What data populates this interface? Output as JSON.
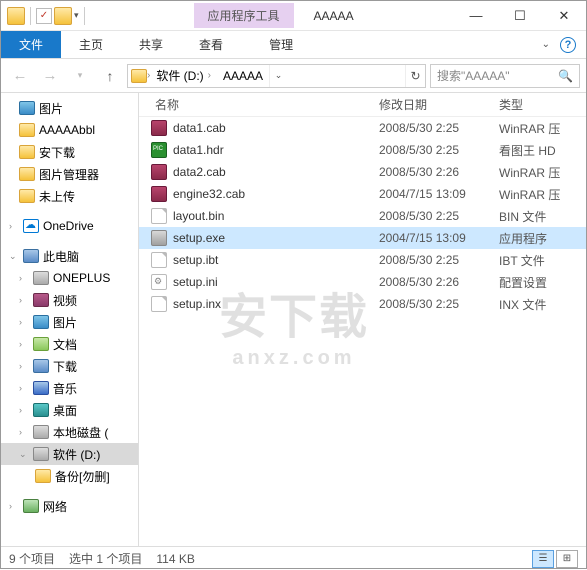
{
  "titlebar": {
    "contextual": "应用程序工具",
    "title": "AAAAA"
  },
  "ribbon": {
    "file": "文件",
    "home": "主页",
    "share": "共享",
    "view": "查看",
    "manage": "管理"
  },
  "address": {
    "drive": "软件 (D:)",
    "folder": "AAAAA"
  },
  "search": {
    "placeholder": "搜索\"AAAAA\""
  },
  "tree": {
    "pictures": "图片",
    "aaaaabbl": "AAAAAbbl",
    "axz": "安下载",
    "picmgr": "图片管理器",
    "wsc": "未上传",
    "onedrive": "OneDrive",
    "thispc": "此电脑",
    "oneplus": "ONEPLUS",
    "video": "视频",
    "pics2": "图片",
    "docs": "文档",
    "dl": "下载",
    "music": "音乐",
    "desktop": "桌面",
    "ldisk": "本地磁盘 (",
    "sdisk": "软件 (D:)",
    "backup": "备份[勿删]",
    "net": "网络"
  },
  "columns": {
    "name": "名称",
    "date": "修改日期",
    "type": "类型"
  },
  "files": [
    {
      "name": "data1.cab",
      "date": "2008/5/30 2:25",
      "type": "WinRAR 压",
      "ico": "cab",
      "sel": false
    },
    {
      "name": "data1.hdr",
      "date": "2008/5/30 2:25",
      "type": "看图王 HD",
      "ico": "hdr",
      "sel": false
    },
    {
      "name": "data2.cab",
      "date": "2008/5/30 2:26",
      "type": "WinRAR 压",
      "ico": "cab",
      "sel": false
    },
    {
      "name": "engine32.cab",
      "date": "2004/7/15 13:09",
      "type": "WinRAR 压",
      "ico": "cab",
      "sel": false
    },
    {
      "name": "layout.bin",
      "date": "2008/5/30 2:25",
      "type": "BIN 文件",
      "ico": "doc",
      "sel": false
    },
    {
      "name": "setup.exe",
      "date": "2004/7/15 13:09",
      "type": "应用程序",
      "ico": "exe",
      "sel": true
    },
    {
      "name": "setup.ibt",
      "date": "2008/5/30 2:25",
      "type": "IBT 文件",
      "ico": "doc",
      "sel": false
    },
    {
      "name": "setup.ini",
      "date": "2008/5/30 2:26",
      "type": "配置设置",
      "ico": "ini",
      "sel": false
    },
    {
      "name": "setup.inx",
      "date": "2008/5/30 2:25",
      "type": "INX 文件",
      "ico": "doc",
      "sel": false
    }
  ],
  "status": {
    "count": "9 个项目",
    "selected": "选中 1 个项目",
    "size": "114 KB"
  },
  "watermark": {
    "main": "安下载",
    "sub": "anxz.com"
  }
}
